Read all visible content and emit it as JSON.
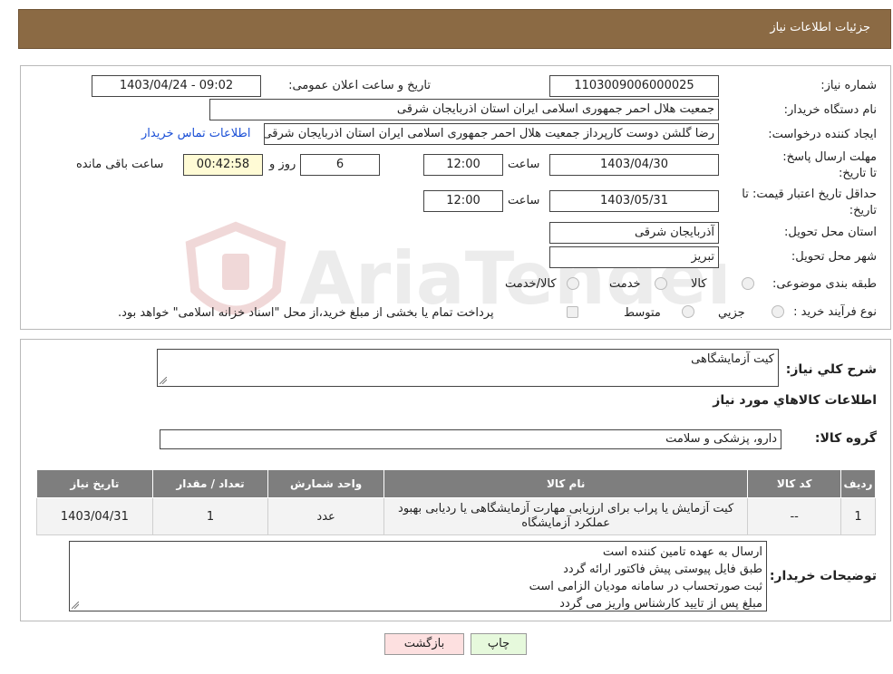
{
  "header": {
    "title": "جزئیات اطلاعات نیاز"
  },
  "form": {
    "need_number_label": "شماره نیاز:",
    "need_number": "1103009006000025",
    "announce_label": "تاریخ و ساعت اعلان عمومی:",
    "announce_value": "1403/04/24 - 09:02",
    "buyer_org_label": "نام دستگاه خریدار:",
    "buyer_org": "جمعیت هلال احمر جمهوری اسلامی ایران استان اذربایجان شرقی",
    "requester_label": "ایجاد کننده درخواست:",
    "requester": "رضا گلشن دوست کارپرداز جمعیت هلال احمر جمهوری اسلامی ایران استان اذربایجان شرقی",
    "contact_link": "اطلاعات تماس خریدار",
    "deadline_label": "مهلت ارسال پاسخ: تا تاریخ:",
    "deadline_date": "1403/04/30",
    "time_label": "ساعت",
    "deadline_time": "12:00",
    "days_value": "6",
    "days_label": "روز و",
    "remaining_time": "00:42:58",
    "remaining_label": "ساعت باقی مانده",
    "validity_label": "حداقل تاریخ اعتبار قیمت: تا تاریخ:",
    "validity_date": "1403/05/31",
    "validity_time": "12:00",
    "province_label": "استان محل تحویل:",
    "province": "آذربایجان شرقی",
    "city_label": "شهر محل تحویل:",
    "city": "تبریز",
    "category_label": "طبقه بندی موضوعی:",
    "category_options": [
      "کالا",
      "خدمت",
      "کالا/خدمت"
    ],
    "process_label": "نوع فرآیند خرید :",
    "process_options": [
      "جزیي",
      "متوسط"
    ],
    "process_note": "پرداخت تمام یا بخشی از مبلغ خرید،از محل \"اسناد خزانه اسلامی\" خواهد بود."
  },
  "description": {
    "label": "شرح كلي نياز:",
    "value": "کیت آزمایشگاهی",
    "goods_title": "اطلاعات كالاهاي مورد نياز",
    "group_label": "گروه کالا:",
    "group_value": "دارو، پزشکی و سلامت"
  },
  "table": {
    "headers": [
      "ردیف",
      "کد کالا",
      "نام کالا",
      "واحد شمارش",
      "تعداد / مقدار",
      "تاریخ نیاز"
    ],
    "rows": [
      [
        "1",
        "--",
        "کیت آزمایش یا پراب برای ارزیابی مهارت آزمایشگاهی یا ردیابی بهبود عملکرد آزمایشگاه",
        "عدد",
        "1",
        "1403/04/31"
      ]
    ]
  },
  "notes": {
    "label": "توضیحات خریدار:",
    "lines": [
      "ارسال به عهده تامین کننده است",
      "طبق فایل پیوستی پیش فاکتور ارائه گردد",
      "ثبت صورتحساب در سامانه مودیان الزامی است",
      "مبلغ پس از تایید کارشناس واریز می گردد"
    ]
  },
  "buttons": {
    "print": "چاپ",
    "back": "بازگشت"
  },
  "colors": {
    "header_bg": "#8b6a44",
    "print_bg": "#e6f9dc",
    "back_bg": "#fde0e0",
    "link": "#1a4fd6"
  },
  "watermark": {
    "text": "AriaTender.neT"
  }
}
